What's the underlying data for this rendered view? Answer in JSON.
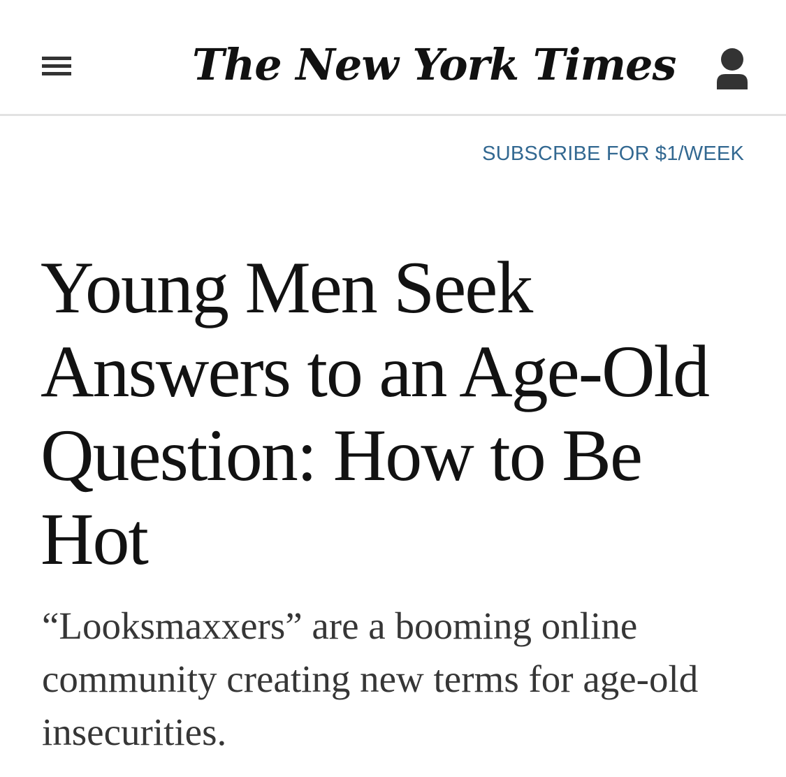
{
  "header": {
    "menu_icon": "hamburger-menu-icon",
    "masthead": "The New York Times",
    "account_icon": "person-icon"
  },
  "subscribe": {
    "label": "SUBSCRIBE FOR $1/WEEK"
  },
  "article": {
    "headline": "Young Men Seek Answers to an Age-Old Question: How to Be Hot",
    "summary": "“Looksmaxxers” are a booming online community creating new terms for age-old insecurities."
  },
  "colors": {
    "subscribe_link": "#326891",
    "headline": "#121212",
    "summary": "#363636",
    "header_divider": "#e2e2e2"
  }
}
